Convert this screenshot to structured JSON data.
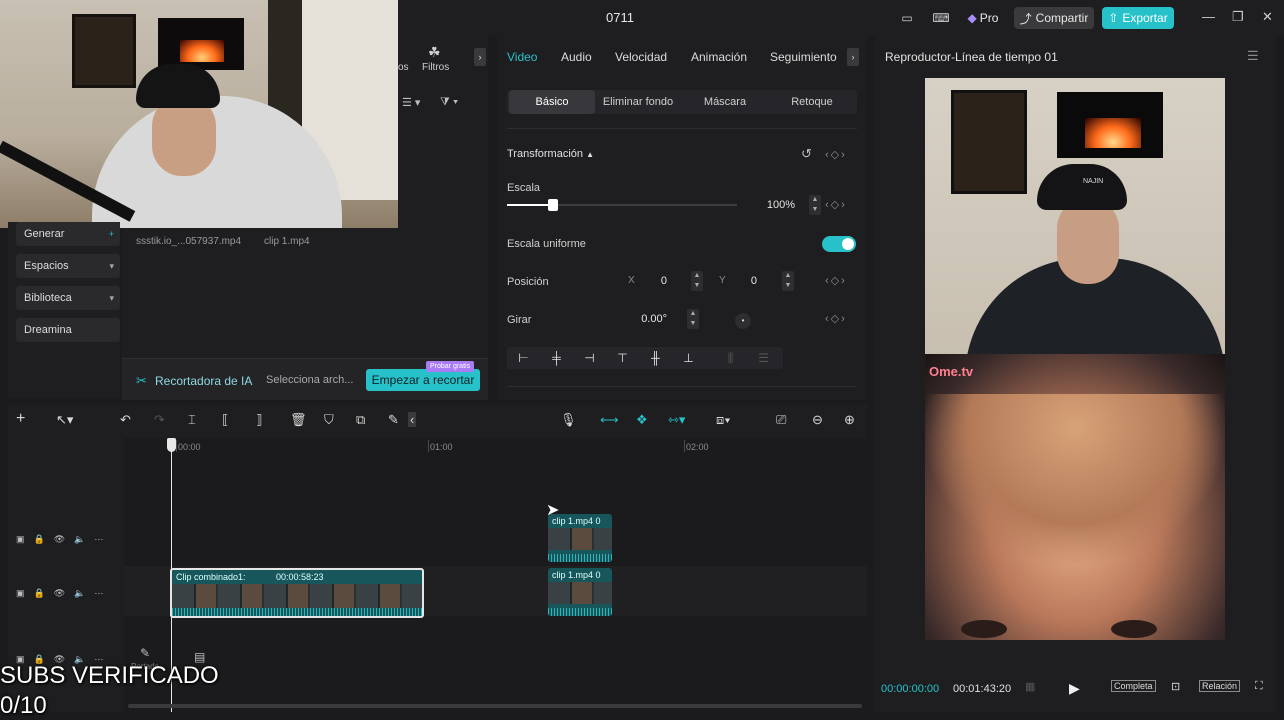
{
  "app": {
    "project_name": "0711",
    "pro_label": "Pro",
    "share_label": "Compartir",
    "export_label": "Exportar",
    "colors": {
      "accent": "#26c1c9",
      "pro": "#a98cf5",
      "background": "#1b1b1d",
      "panel": "#1e1e20"
    }
  },
  "left_nav": {
    "items": [
      {
        "label": "Generar",
        "icon": "plus-badge-icon"
      },
      {
        "label": "Espacios",
        "icon": "chevron-down-icon"
      },
      {
        "label": "Biblioteca",
        "icon": "chevron-down-icon"
      },
      {
        "label": "Dreamina",
        "icon": ""
      }
    ]
  },
  "media": {
    "files": [
      "ssstik.io_...057937.mp4",
      "clip 1.mp4"
    ],
    "filter_tab_label": "Filtros",
    "filter_tab_partial": "os",
    "ia_title": "Recortadora de IA",
    "ia_select": "Selecciona arch...",
    "ia_button": "Empezar a recortar",
    "ia_badge": "Probar gratis"
  },
  "inspector": {
    "tabs": [
      "Video",
      "Audio",
      "Velocidad",
      "Animación",
      "Seguimiento"
    ],
    "active_tab": "Video",
    "subtabs": [
      "Básico",
      "Eliminar fondo",
      "Máscara",
      "Retoque"
    ],
    "active_subtab": "Básico",
    "section": "Transformación",
    "scale_label": "Escala",
    "scale_value": "100%",
    "scale_fraction": 0.2,
    "uniform_scale_label": "Escala uniforme",
    "uniform_scale_on": true,
    "position_label": "Posición",
    "x_label": "X",
    "x_value": "0",
    "y_label": "Y",
    "y_value": "0",
    "rotate_label": "Girar",
    "rotate_value": "0.00°",
    "align_icons": [
      "align-left-icon",
      "align-center-h-icon",
      "align-right-icon",
      "align-top-icon",
      "align-middle-v-icon",
      "align-bottom-icon",
      "distribute-h-icon",
      "distribute-v-icon"
    ]
  },
  "player": {
    "title": "Reproductor-Línea de tiempo 01",
    "current_time": "00:00:00:00",
    "total_time": "00:01:43:20",
    "full_label": "Completa",
    "ratio_label": "Relación",
    "overlay_logo": "Ome.tv",
    "cap_text": "NAJIN"
  },
  "timeline": {
    "ruler": [
      "00:00",
      "01:00",
      "02:00"
    ],
    "main_clip_name": "Clip combinado1:",
    "main_clip_duration": "00:00:58:23",
    "clip_a": "clip 1.mp4",
    "clip_a_suffix": "0",
    "clip_b": "clip 1.mp4",
    "clip_b_suffix": "0",
    "cover_label": "Portada"
  },
  "stream_overlay": {
    "line1": "SUBS VERIFICADO",
    "line2": "0/10"
  }
}
